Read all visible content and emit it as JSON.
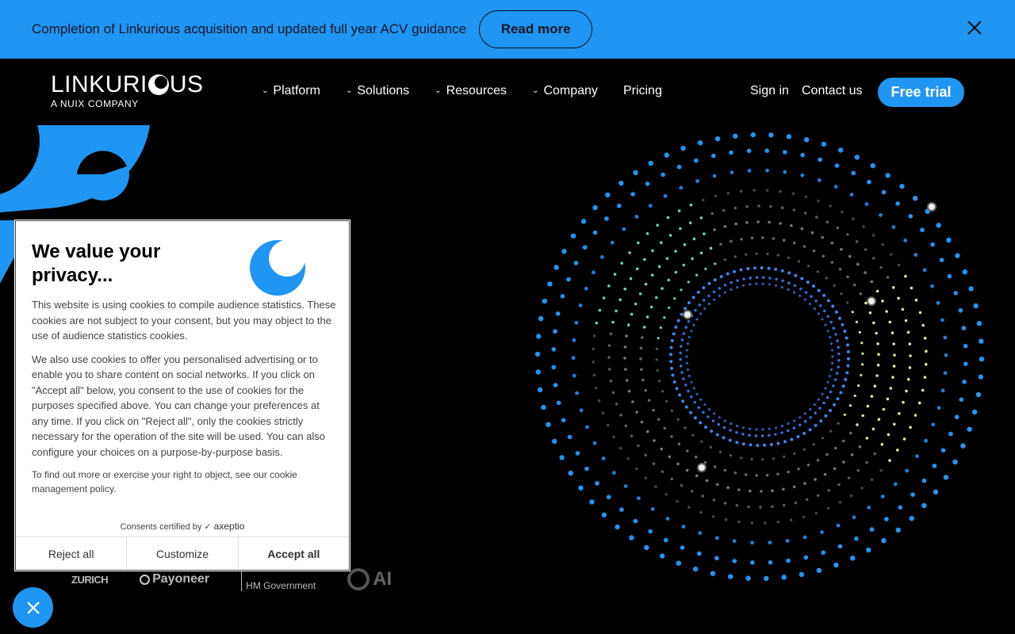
{
  "banner": {
    "text": "Completion of Linkurious acquisition and updated full year ACV guidance",
    "button_label": "Read more",
    "close_icon": "close-icon"
  },
  "header": {
    "logo_word_left": "LINKURI",
    "logo_word_right": "US",
    "logo_sub": "A NUIX COMPANY",
    "nav": [
      {
        "label": "Platform",
        "has_dropdown": true
      },
      {
        "label": "Solutions",
        "has_dropdown": true
      },
      {
        "label": "Resources",
        "has_dropdown": true
      },
      {
        "label": "Company",
        "has_dropdown": true
      },
      {
        "label": "Pricing",
        "has_dropdown": false
      }
    ],
    "sign_in": "Sign in",
    "contact": "Contact us",
    "free_trial": "Free trial"
  },
  "logos": {
    "zurich": "ZURICH",
    "payoneer": "Payoneer",
    "hm_government": "HM Government",
    "partial": "AI"
  },
  "cookie": {
    "title": "We value your privacy...",
    "paragraph1": "This website is using cookies to compile audience statistics. These cookies are not subject to your consent, but you may object to the use of audience statistics cookies.",
    "paragraph2": "We also use cookies to offer you personalised advertising or to enable you to share content on social networks. If you click on \"Accept all\" below, you consent to the use of cookies for the purposes specified above. You can change your preferences at any time. If you click on \"Reject all\", only the cookies strictly necessary for the operation of the site will be used. You can also configure your choices on a purpose-by-purpose basis.",
    "paragraph3": "To find out more or exercise your right to object, see our cookie management policy.",
    "certified_prefix": "Consents certified by",
    "certified_brand": "axeptio",
    "reject": "Reject all",
    "customize": "Customize",
    "accept": "Accept all"
  },
  "colors": {
    "accent": "#1f96f3",
    "background": "#000000"
  }
}
